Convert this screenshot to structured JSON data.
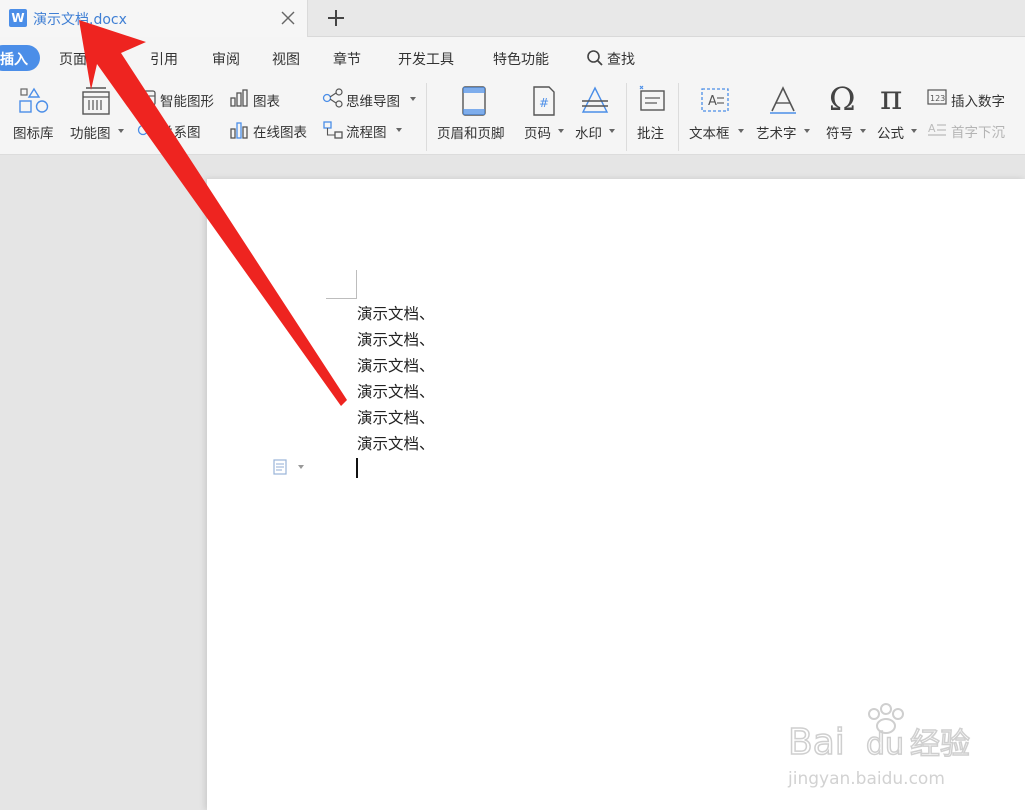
{
  "tab": {
    "icon": "W",
    "title": "演示文档.docx"
  },
  "menu": {
    "active": "插入",
    "items": [
      "页面布局",
      "引用",
      "审阅",
      "视图",
      "章节",
      "开发工具",
      "特色功能"
    ],
    "search": "查找"
  },
  "ribbon": {
    "icon_lib": "图标库",
    "func_chart": "功能图",
    "smart_shape": "智能图形",
    "chart": "图表",
    "relation": "关系图",
    "online_chart": "在线图表",
    "mindmap": "思维导图",
    "flowchart": "流程图",
    "header_footer": "页眉和页脚",
    "page_num": "页码",
    "watermark": "水印",
    "comment": "批注",
    "textbox": "文本框",
    "wordart": "艺术字",
    "symbol": "符号",
    "formula": "公式",
    "insert_number": "插入数字",
    "drop_cap": "首字下沉"
  },
  "document": {
    "lines": [
      "演示文档、",
      "演示文档、",
      "演示文档、",
      "演示文档、",
      "演示文档、",
      "演示文档、"
    ]
  },
  "watermark": {
    "brand": "Bai",
    "brand2": "du",
    "brand_cn": "经验",
    "url": "jingyan.baidu.com"
  },
  "colors": {
    "accent": "#4b8ee8",
    "arrow": "#ee2420",
    "title": "#3f7fd4"
  }
}
